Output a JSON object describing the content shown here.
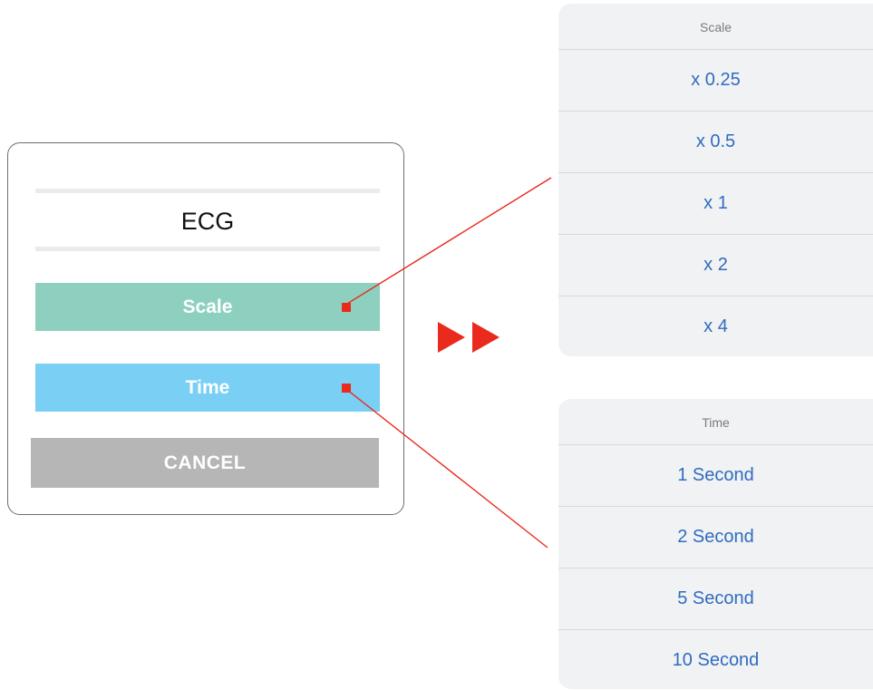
{
  "dialog": {
    "title": "ECG",
    "buttons": {
      "scale": "Scale",
      "time": "Time",
      "cancel": "CANCEL"
    }
  },
  "scale_sheet": {
    "header": "Scale",
    "options": [
      "x 0.25",
      "x 0.5",
      "x 1",
      "x 2",
      "x 4"
    ]
  },
  "time_sheet": {
    "header": "Time",
    "options": [
      "1 Second",
      "2 Second",
      "5 Second",
      "10 Second"
    ]
  },
  "icons": {
    "arrow": "double-play-arrow-icon",
    "marker": "red-square-marker-icon"
  },
  "colors": {
    "scale_button": "#8ed0c0",
    "time_button": "#79cff4",
    "cancel_button": "#b5b6b5",
    "accent_red": "#ea2a1d",
    "option_text": "#2f6cbf"
  }
}
